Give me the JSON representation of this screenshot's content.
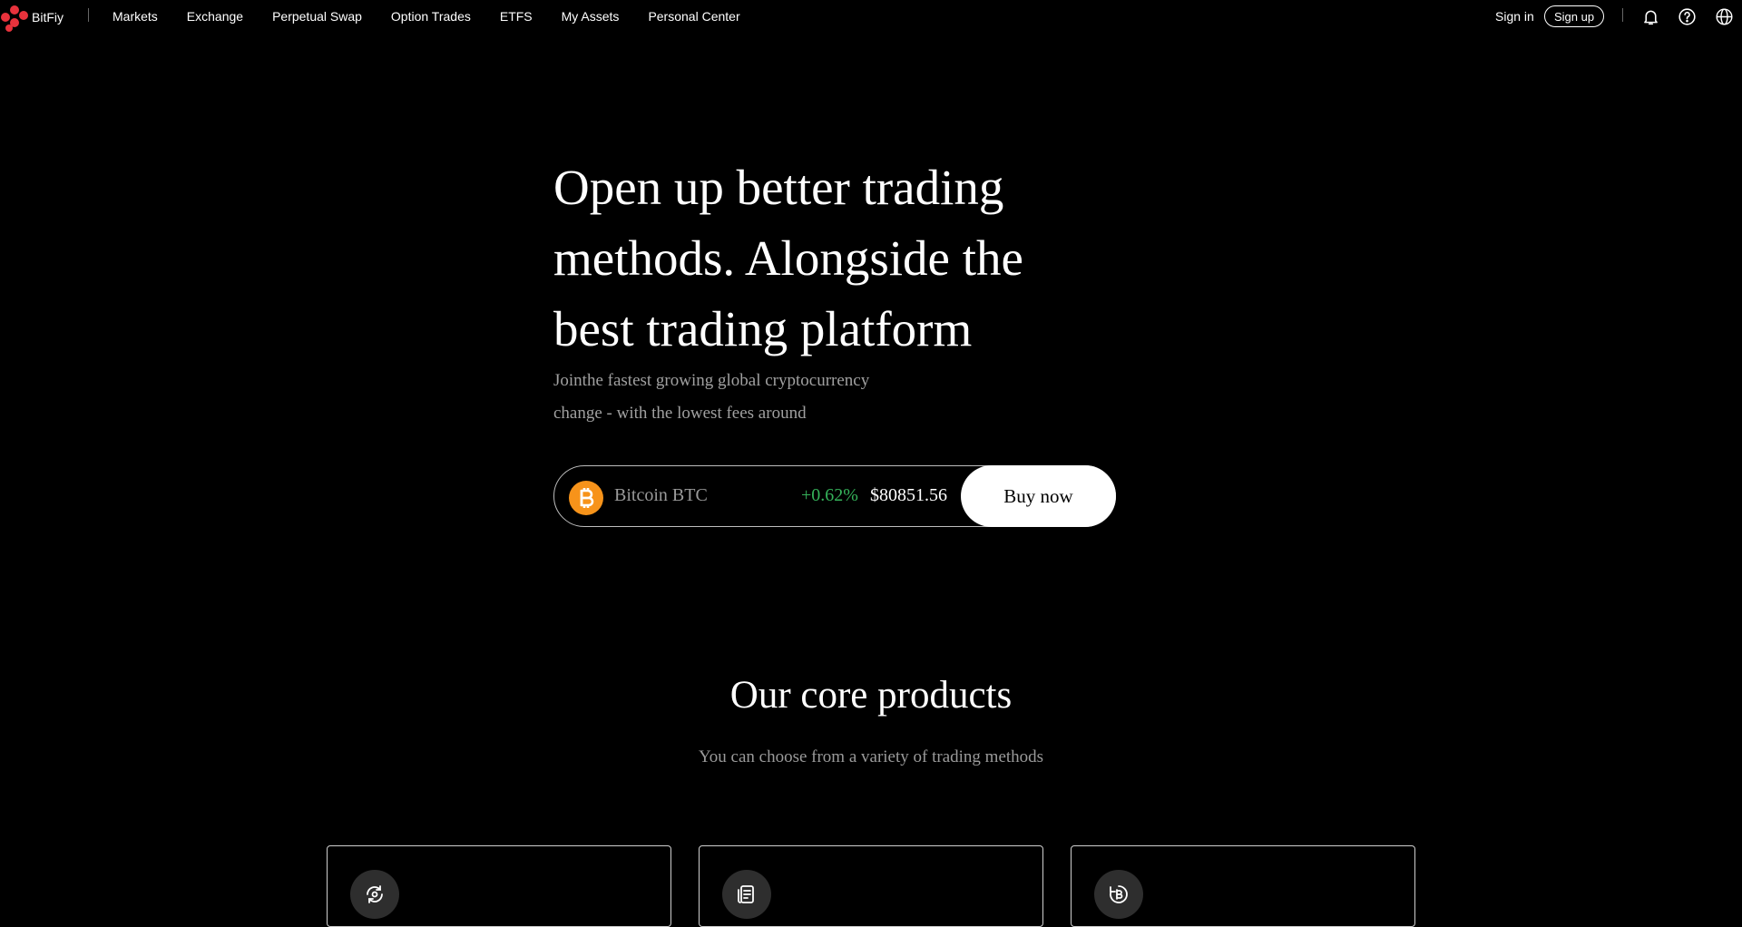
{
  "header": {
    "brand": "BitFiy",
    "nav": [
      "Markets",
      "Exchange",
      "Perpetual Swap",
      "Option Trades",
      "ETFS",
      "My Assets",
      "Personal Center"
    ],
    "signin": "Sign in",
    "signup": "Sign up",
    "icons": [
      "bell-icon",
      "help-icon",
      "globe-icon"
    ]
  },
  "hero": {
    "title": "Open up better trading methods. Alongside the best trading platform",
    "subtitle": "Jointhe fastest growing global cryptocurrency change - with the lowest fees around",
    "ticker": {
      "coin": "Bitcoin BTC",
      "change": "+0.62%",
      "price": "$80851.56",
      "buy_label": "Buy now",
      "change_color": "#35b25a",
      "coin_color": "#f7931a"
    }
  },
  "products": {
    "title": "Our core products",
    "subtitle": "You can choose from a variety of trading methods",
    "cards": [
      {
        "icon": "exchange-cycle-icon"
      },
      {
        "icon": "document-icon"
      },
      {
        "icon": "bitcoin-cycle-icon"
      }
    ]
  },
  "colors": {
    "background": "#000000",
    "brand_red": "#e8323c"
  }
}
